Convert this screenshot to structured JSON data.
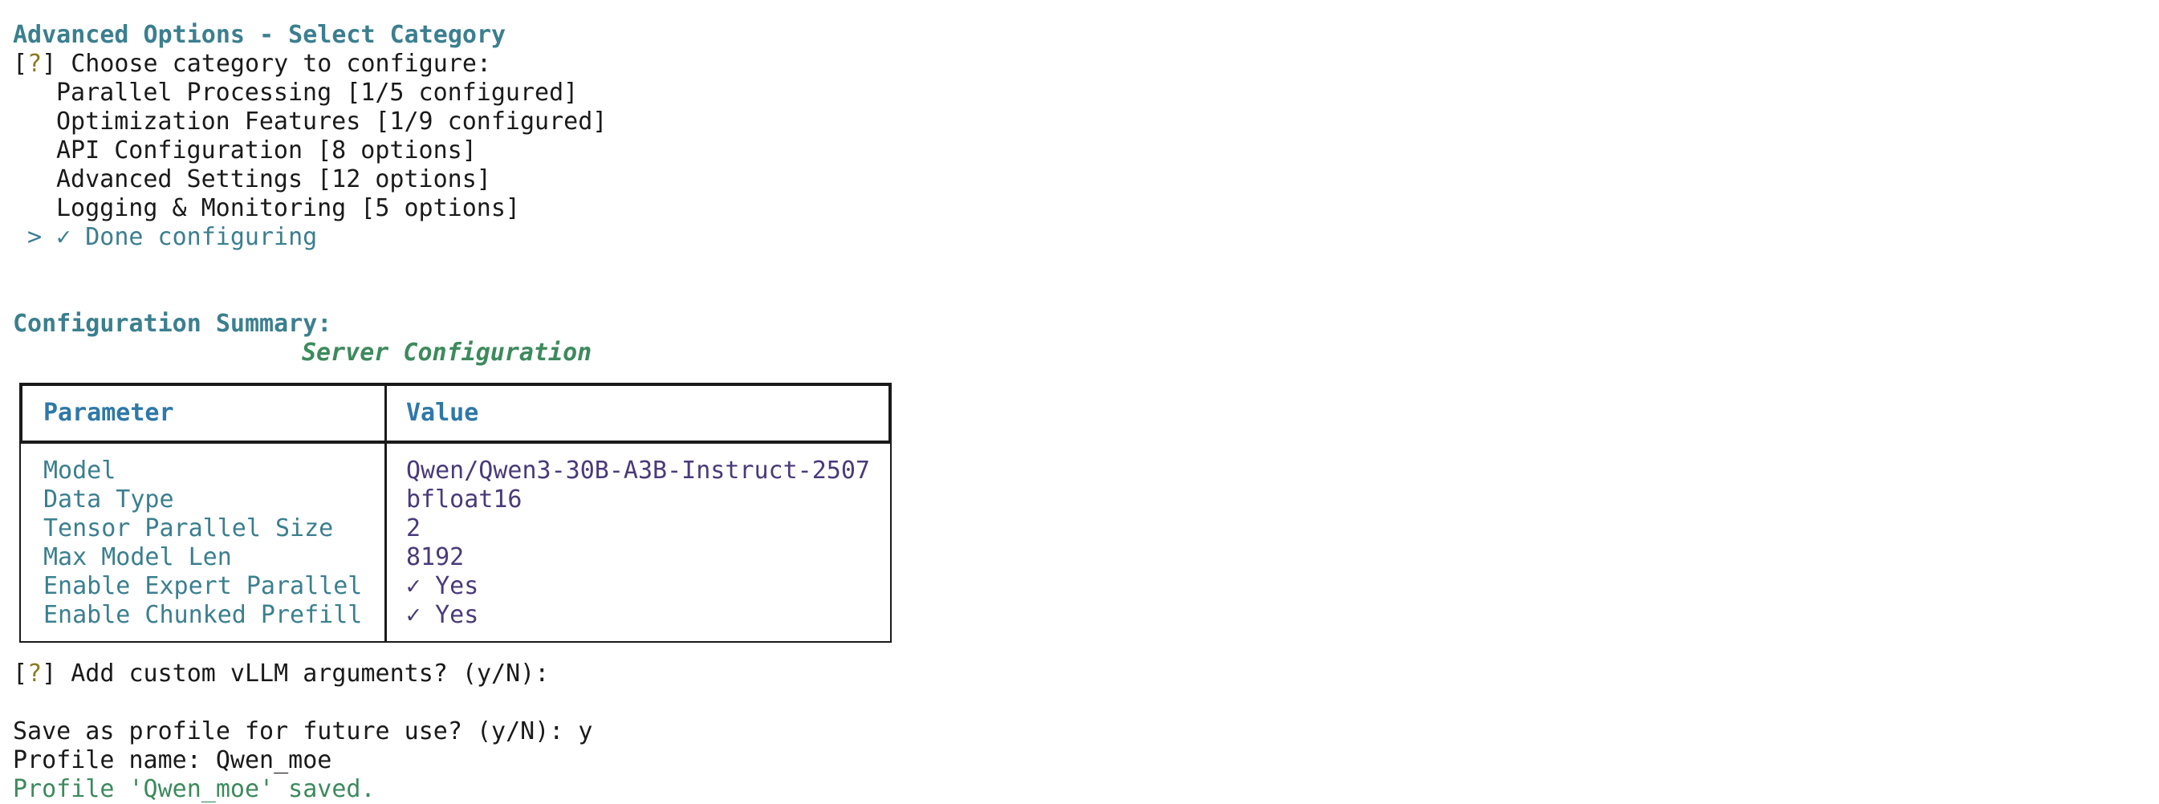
{
  "menu": {
    "title": "Advanced Options - Select Category",
    "prompt_marker_open": "[",
    "prompt_marker_q": "?",
    "prompt_marker_close": "]",
    "prompt": " Choose category to configure:",
    "items": [
      {
        "label": "Parallel Processing [1/5 configured]"
      },
      {
        "label": "Optimization Features [1/9 configured]"
      },
      {
        "label": "API Configuration [8 options]"
      },
      {
        "label": "Advanced Settings [12 options]"
      },
      {
        "label": "Logging & Monitoring [5 options]"
      }
    ],
    "selected_item": "> ✓ Done configuring"
  },
  "summary": {
    "heading": "Configuration Summary:",
    "table_title": "Server Configuration",
    "columns": [
      "Parameter",
      "Value"
    ],
    "rows": [
      {
        "param": "Model",
        "value": "Qwen/Qwen3-30B-A3B-Instruct-2507"
      },
      {
        "param": "Data Type",
        "value": "bfloat16"
      },
      {
        "param": "Tensor Parallel Size",
        "value": "2"
      },
      {
        "param": "Max Model Len",
        "value": "8192"
      },
      {
        "param": "Enable Expert Parallel",
        "value": "✓ Yes"
      },
      {
        "param": "Enable Chunked Prefill",
        "value": "✓ Yes"
      }
    ]
  },
  "prompts": {
    "custom_args": " Add custom vLLM arguments? (y/N):",
    "save_profile": "Save as profile for future use? (y/N): y",
    "profile_name": "Profile name: Qwen_moe",
    "saved_message": "Profile 'Qwen_moe' saved."
  },
  "colors": {
    "teal": "#3b7f8f",
    "blue_header": "#2f78a8",
    "value_purple": "#4a3a7a",
    "green": "#3d8a5d",
    "prompt_q": "#8a7a1f"
  }
}
